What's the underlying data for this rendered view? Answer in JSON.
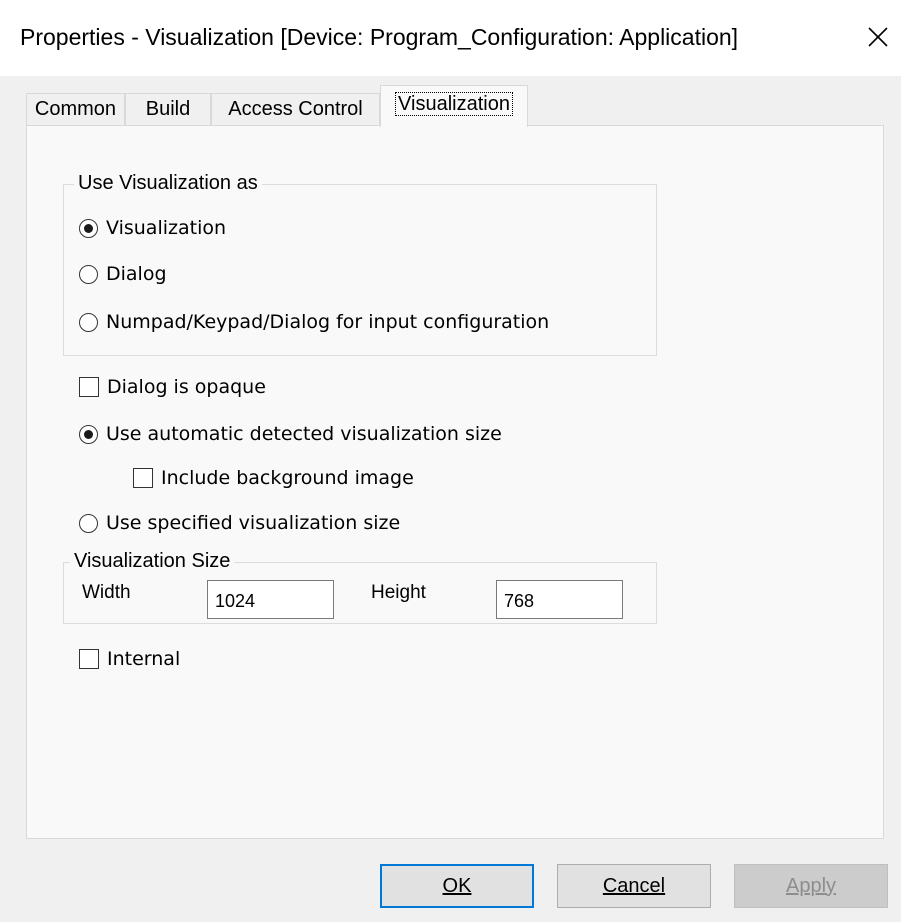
{
  "window": {
    "title": "Properties - Visualization [Device: Program_Configuration: Application]",
    "close_icon": "close-icon"
  },
  "tabs": [
    {
      "label": "Common"
    },
    {
      "label": "Build"
    },
    {
      "label": "Access Control"
    },
    {
      "label": "Visualization",
      "active": true
    }
  ],
  "use_as": {
    "legend": "Use Visualization as",
    "options": [
      {
        "label": "Visualization",
        "selected": true
      },
      {
        "label": "Dialog",
        "selected": false
      },
      {
        "label": "Numpad/Keypad/Dialog for input configuration",
        "selected": false
      }
    ]
  },
  "options": {
    "dialog_opaque": {
      "label": "Dialog is opaque",
      "checked": false
    },
    "auto_size": {
      "label": "Use automatic detected visualization size",
      "selected": true
    },
    "include_bg": {
      "label": "Include background image",
      "checked": false
    },
    "specified_size": {
      "label": "Use specified visualization size",
      "selected": false
    }
  },
  "size": {
    "legend": "Visualization Size",
    "width_label": "Width",
    "width_value": "1024",
    "height_label": "Height",
    "height_value": "768"
  },
  "internal": {
    "label": "Internal",
    "checked": false
  },
  "buttons": {
    "ok": "OK",
    "cancel": "Cancel",
    "apply": "Apply"
  }
}
